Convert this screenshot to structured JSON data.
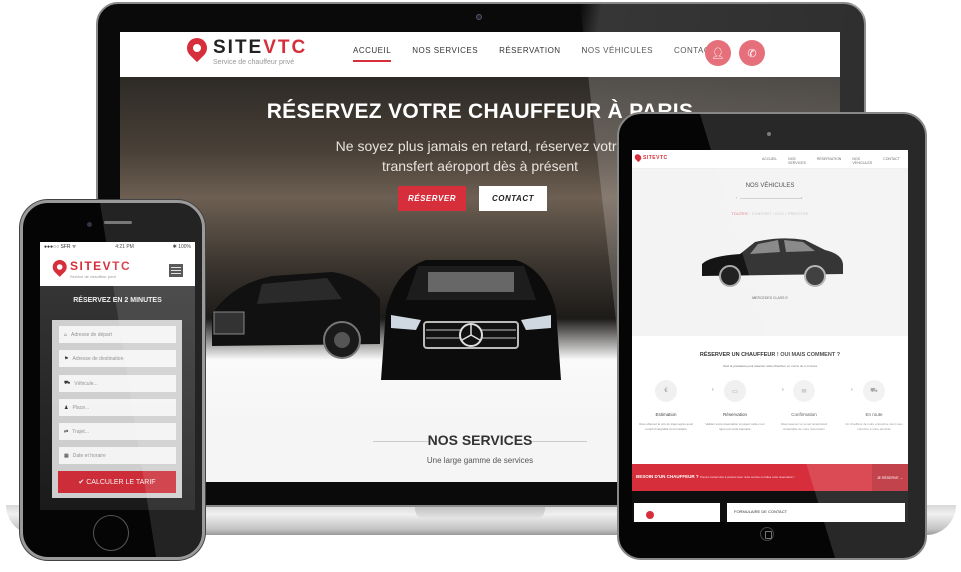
{
  "laptop": {
    "brand": {
      "name_a": "SITE",
      "name_b": "VTC",
      "tagline": "Service de chauffeur privé"
    },
    "nav": {
      "items": [
        {
          "label": "ACCUEIL",
          "active": true
        },
        {
          "label": "NOS SERVICES",
          "active": false
        },
        {
          "label": "RÉSERVATION",
          "active": false
        },
        {
          "label": "NOS VÉHICULES",
          "active": false
        },
        {
          "label": "CONTACT",
          "active": false
        }
      ],
      "icons": [
        "user-icon",
        "phone-icon"
      ]
    },
    "hero": {
      "title": "RÉSERVEZ VOTRE CHAUFFEUR À PARIS",
      "subtitle_line1": "Ne soyez plus jamais en retard, réservez votre",
      "subtitle_line2": "transfert aéroport dès à présent",
      "primary_button": "RÉSERVER",
      "secondary_button": "CONTACT"
    },
    "services": {
      "title": "NOS SERVICES",
      "subtitle": "Une large gamme de services"
    }
  },
  "phone": {
    "status": {
      "carrier": "●●●○○ SFR ᯤ",
      "time": "4:21 PM",
      "battery": "✱ 100%"
    },
    "heading": "RÉSERVEZ EN 2 MINUTES",
    "fields": [
      {
        "icon": "⌂",
        "placeholder": "Adresse de départ"
      },
      {
        "icon": "⚑",
        "placeholder": "Adresse de destination"
      },
      {
        "icon": "⛟",
        "placeholder": "Véhicule..."
      },
      {
        "icon": "♟",
        "placeholder": "Place..."
      },
      {
        "icon": "⇄",
        "placeholder": "Trajet..."
      },
      {
        "icon": "▦",
        "placeholder": "Date et horaire"
      }
    ],
    "submit": "✔ CALCULER LE TARIF"
  },
  "tablet": {
    "nav": [
      "ACCUEIL",
      "NOS SERVICES",
      "RÉSERVATION",
      "NOS VÉHICULES",
      "CONTACT"
    ],
    "vehicles_title": "NOS VÉHICULES",
    "filters": {
      "active": "TOUTES",
      "rest": " / CONFORT / ECO / PRESTIGE"
    },
    "car_label": "MERCEDES CLASS E",
    "how_title": "RÉSERVER UN CHAUFFEUR ! OUI MAIS COMMENT ?",
    "how_sub": "Voici la procédure pour réserver votre chauffeur en moins de 2 minutes",
    "steps": [
      {
        "icon": "€",
        "name": "Estimation",
        "desc": "Vous obtenez le prix du trajet après avoir rempli l'intégralité du formulaire"
      },
      {
        "icon": "▭",
        "name": "Réservation",
        "desc": "Validez votre réservation et payez celle-ci en ligne par carte bancaire"
      },
      {
        "icon": "✉",
        "name": "Confirmation",
        "desc": "Vous recevez un email récapitulant l'ensemble de votre réservation"
      },
      {
        "icon": "⛟",
        "name": "En route",
        "desc": "Un chauffeur de notre entreprise vient vous chercher à votre domicile"
      }
    ],
    "cta": {
      "title": "BESOIN D'UN CHAUFFEUR ?",
      "text": "Prenez contact dès à présent avec notre service ou faites votre réservation !",
      "button": "JE RÉSERVE →"
    },
    "contact_title": "FORMULAIRE DE CONTACT"
  }
}
